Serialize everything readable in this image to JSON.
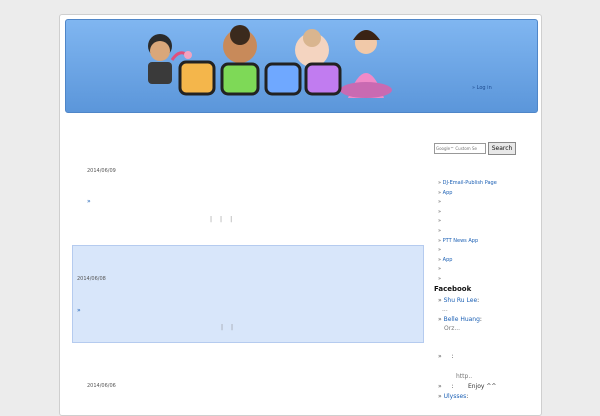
{
  "header": {
    "tagline": "",
    "login_label": "Log in",
    "login_extra": ""
  },
  "posts": [
    {
      "title": "",
      "date": "2014/06/09",
      "excerpt": "",
      "more_label": "",
      "pager": {
        "prev": "",
        "item2": "",
        "item3": "",
        "next": ""
      }
    },
    {
      "title": "",
      "date": "2014/06/08",
      "excerpt": "",
      "more_label": "",
      "pager": {
        "item1": "",
        "item2": "",
        "next": ""
      }
    },
    {
      "title": "",
      "date": "2014/06/06"
    }
  ],
  "sidebar": {
    "search_placeholder": "Google™ Custom Se",
    "search_button": "Search",
    "links": [
      "DJ-Email-Publish Page",
      "App",
      "",
      "",
      "",
      "",
      "PTT News App",
      "",
      "App",
      "",
      ""
    ],
    "facebook_title": "Facebook",
    "comments": [
      {
        "name": "Shu Ru Lee",
        "text": "..."
      },
      {
        "name": "Belle Huang",
        "text": "Orz..."
      },
      {
        "name": "",
        "text": ""
      },
      {
        "name": "",
        "text": "http.."
      },
      {
        "name": "",
        "text": "Enjoy ^^"
      },
      {
        "name": "Ulysses",
        "text": ""
      }
    ]
  },
  "colors": {
    "header_top": "#80b6f1",
    "header_bottom": "#5b96da",
    "link": "#1a5fb4",
    "highlight_post": "#d8e6fa"
  }
}
